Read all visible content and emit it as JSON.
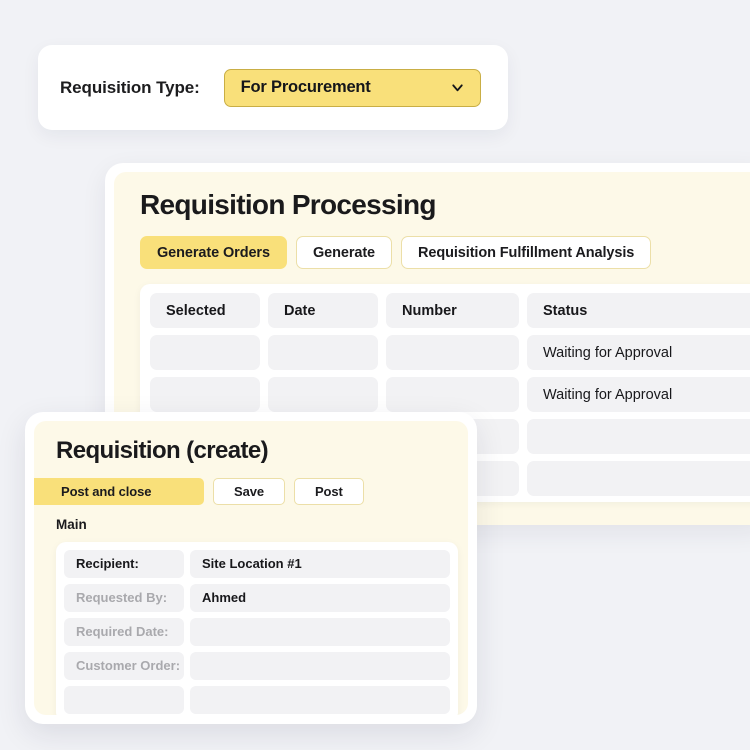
{
  "type_bar": {
    "label": "Requisition Type:",
    "selected": "For Procurement",
    "chevron_icon": "chevron-down-icon",
    "accent": "#F9E07A"
  },
  "main_card": {
    "title": "Requisition Processing",
    "tabs": [
      {
        "label": "Generate Orders",
        "active": true
      },
      {
        "label": "Generate",
        "active": false
      },
      {
        "label": "Requisition Fulfillment Analysis",
        "active": false
      }
    ],
    "table": {
      "columns": [
        "Selected",
        "Date",
        "Number",
        "Status"
      ],
      "rows": [
        {
          "selected": "",
          "date": "",
          "number": "",
          "status": "Waiting for Approval"
        },
        {
          "selected": "",
          "date": "",
          "number": "",
          "status": "Waiting for Approval"
        },
        {
          "selected": "",
          "date": "",
          "number": "",
          "status": ""
        },
        {
          "selected": "",
          "date": "",
          "number": "",
          "status": ""
        }
      ]
    }
  },
  "modal": {
    "title": "Requisition (create)",
    "actions": [
      {
        "label": "Post and close",
        "primary": true
      },
      {
        "label": "Save",
        "primary": false
      },
      {
        "label": "Post",
        "primary": false
      }
    ],
    "section_label": "Main",
    "fields": [
      {
        "label": "Recipient:",
        "value": "Site Location #1",
        "label_strong": true
      },
      {
        "label": "Requested By:",
        "value": "Ahmed",
        "label_strong": false
      },
      {
        "label": "Required Date:",
        "value": "",
        "label_strong": false
      },
      {
        "label": "Customer Order:",
        "value": "",
        "label_strong": false
      },
      {
        "label": "",
        "value": "",
        "label_strong": false
      }
    ]
  }
}
